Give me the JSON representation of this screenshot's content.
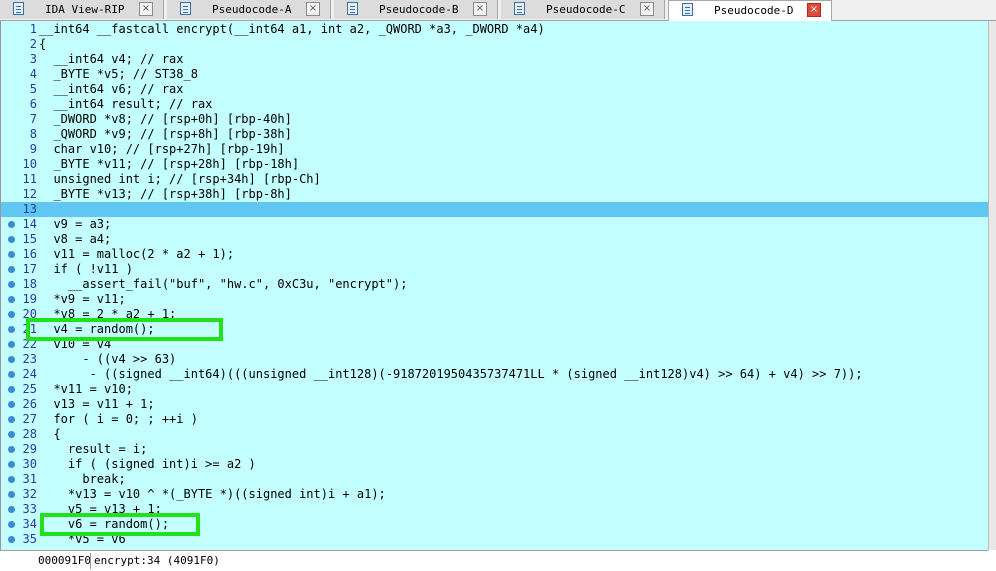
{
  "tabs": [
    {
      "label": "IDA View-RIP",
      "active": false
    },
    {
      "label": "Pseudocode-A",
      "active": false
    },
    {
      "label": "Pseudocode-B",
      "active": false
    },
    {
      "label": "Pseudocode-C",
      "active": false
    },
    {
      "label": "Pseudocode-D",
      "active": true
    }
  ],
  "tab_close_glyph": "×",
  "highlight_line": 13,
  "breakpoint_lines": [
    14,
    15,
    16,
    17,
    18,
    19,
    20,
    21,
    22,
    23,
    24,
    25,
    26,
    27,
    28,
    29,
    30,
    31,
    32,
    33,
    34,
    35
  ],
  "boxed_lines": [
    21,
    34
  ],
  "lines": [
    {
      "n": "1",
      "text": "__int64 __fastcall encrypt(__int64 a1, int a2, _QWORD *a3, _DWORD *a4)"
    },
    {
      "n": "2",
      "text": "{"
    },
    {
      "n": "3",
      "text": "  __int64 v4; // rax"
    },
    {
      "n": "4",
      "text": "  _BYTE *v5; // ST38_8"
    },
    {
      "n": "5",
      "text": "  __int64 v6; // rax"
    },
    {
      "n": "6",
      "text": "  __int64 result; // rax"
    },
    {
      "n": "7",
      "text": "  _DWORD *v8; // [rsp+0h] [rbp-40h]"
    },
    {
      "n": "8",
      "text": "  _QWORD *v9; // [rsp+8h] [rbp-38h]"
    },
    {
      "n": "9",
      "text": "  char v10; // [rsp+27h] [rbp-19h]"
    },
    {
      "n": "10",
      "text": "  _BYTE *v11; // [rsp+28h] [rbp-18h]"
    },
    {
      "n": "11",
      "text": "  unsigned int i; // [rsp+34h] [rbp-Ch]"
    },
    {
      "n": "12",
      "text": "  _BYTE *v13; // [rsp+38h] [rbp-8h]"
    },
    {
      "n": "13",
      "text": ""
    },
    {
      "n": "14",
      "text": "  v9 = a3;"
    },
    {
      "n": "15",
      "text": "  v8 = a4;"
    },
    {
      "n": "16",
      "text": "  v11 = malloc(2 * a2 + 1);"
    },
    {
      "n": "17",
      "text": "  if ( !v11 )"
    },
    {
      "n": "18",
      "text": "    __assert_fail(\"buf\", \"hw.c\", 0xC3u, \"encrypt\");"
    },
    {
      "n": "19",
      "text": "  *v9 = v11;"
    },
    {
      "n": "20",
      "text": "  *v8 = 2 * a2 + 1;"
    },
    {
      "n": "21",
      "text": "  v4 = random();"
    },
    {
      "n": "22",
      "text": "  v10 = v4"
    },
    {
      "n": "23",
      "text": "      - ((v4 >> 63)"
    },
    {
      "n": "24",
      "text": "       - ((signed __int64)(((unsigned __int128)(-9187201950435737471LL * (signed __int128)v4) >> 64) + v4) >> 7));"
    },
    {
      "n": "25",
      "text": "  *v11 = v10;"
    },
    {
      "n": "26",
      "text": "  v13 = v11 + 1;"
    },
    {
      "n": "27",
      "text": "  for ( i = 0; ; ++i )"
    },
    {
      "n": "28",
      "text": "  {"
    },
    {
      "n": "29",
      "text": "    result = i;"
    },
    {
      "n": "30",
      "text": "    if ( (signed int)i >= a2 )"
    },
    {
      "n": "31",
      "text": "      break;"
    },
    {
      "n": "32",
      "text": "    *v13 = v10 ^ *(_BYTE *)((signed int)i + a1);"
    },
    {
      "n": "33",
      "text": "    v5 = v13 + 1;"
    },
    {
      "n": "34",
      "text": "    v6 = random();"
    },
    {
      "n": "35",
      "text": "    *v5 = v6"
    }
  ],
  "status": {
    "address": "000091F0",
    "location": "encrypt:34 (4091F0)"
  },
  "colors": {
    "code_bg": "#c4ffff",
    "current_line": "#5fc7f2",
    "annotation_box": "#22e01a",
    "breakpoint_dot": "#3a8ad6"
  }
}
